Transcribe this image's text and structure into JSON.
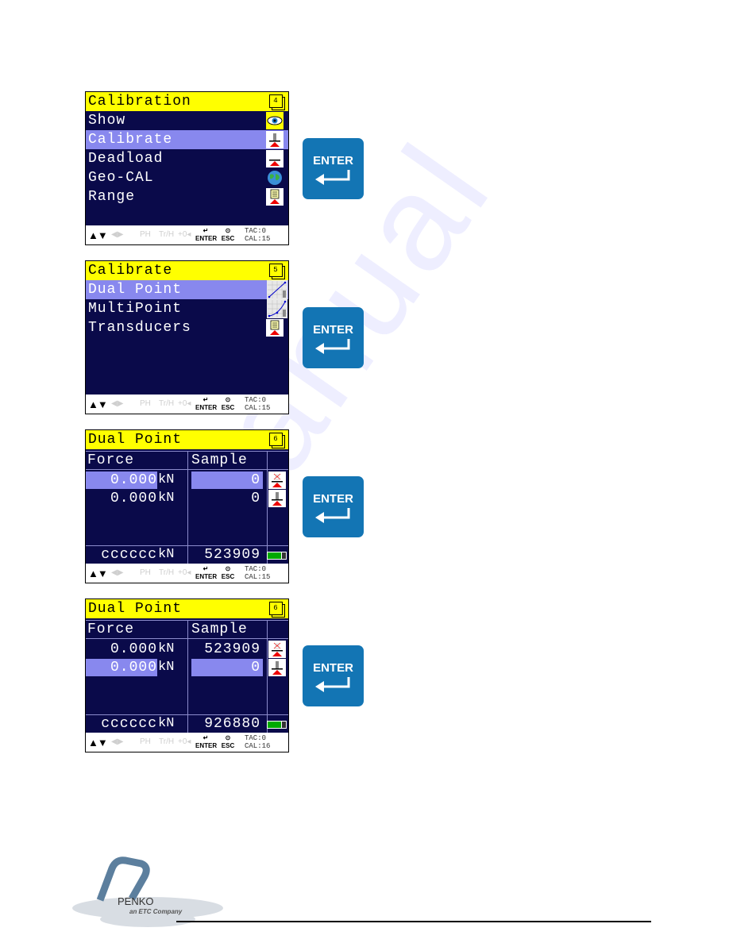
{
  "watermark": "Manual",
  "screens": [
    {
      "title": "Calibration",
      "page": "4",
      "selected_index": 1,
      "items": [
        {
          "label": "Show",
          "icon": "eye-icon"
        },
        {
          "label": "Calibrate",
          "icon": "weight-calibrate-icon"
        },
        {
          "label": "Deadload",
          "icon": "deadload-icon"
        },
        {
          "label": "Geo-CAL",
          "icon": "globe-icon"
        },
        {
          "label": "Range",
          "icon": "range-document-icon"
        }
      ]
    },
    {
      "title": "Calibrate",
      "page": "5",
      "selected_index": 0,
      "items": [
        {
          "label": "Dual Point",
          "icon": "dual-point-graph-icon"
        },
        {
          "label": "MultiPoint",
          "icon": "multipoint-graph-icon"
        },
        {
          "label": "Transducers",
          "icon": "transducer-document-icon"
        }
      ]
    },
    {
      "title": "Dual Point",
      "page": "6",
      "columns": [
        "Force",
        "Sample"
      ],
      "selected_row": 0,
      "rows": [
        {
          "force": "0.000",
          "unit": "kN",
          "sample": "0",
          "icon": "zero-point-icon"
        },
        {
          "force": "0.000",
          "unit": "kN",
          "sample": "0",
          "icon": "weight-point-icon"
        }
      ],
      "live": {
        "force": "cccccc",
        "unit": "kN",
        "sample": "523909"
      }
    },
    {
      "title": "Dual Point",
      "page": "6",
      "columns": [
        "Force",
        "Sample"
      ],
      "selected_row": 1,
      "rows": [
        {
          "force": "0.000",
          "unit": "kN",
          "sample": "523909",
          "icon": "zero-point-icon"
        },
        {
          "force": "0.000",
          "unit": "kN",
          "sample": "0",
          "icon": "weight-point-icon"
        }
      ],
      "live": {
        "force": "cccccc",
        "unit": "kN",
        "sample": "926880"
      }
    }
  ],
  "statusbars": [
    {
      "arrows": "▲▼",
      "faint1": "◀▶",
      "faint2": "PH",
      "faint3": "Tr/H",
      "faint4": "+0◂",
      "enter": "ENTER",
      "esc": "ESC",
      "tac": "TAC:0",
      "cal": "CAL:15"
    },
    {
      "arrows": "▲▼",
      "faint1": "◀▶",
      "faint2": "PH",
      "faint3": "Tr/H",
      "faint4": "+0◂",
      "enter": "ENTER",
      "esc": "ESC",
      "tac": "TAC:0",
      "cal": "CAL:15"
    },
    {
      "arrows": "▲▼",
      "faint1": "◀▶",
      "faint2": "PH",
      "faint3": "Tr/H",
      "faint4": "+0◂",
      "enter": "ENTER",
      "esc": "ESC",
      "tac": "TAC:0",
      "cal": "CAL:15"
    },
    {
      "arrows": "▲▼",
      "faint1": "◀▶",
      "faint2": "PH",
      "faint3": "Tr/H",
      "faint4": "+0◂",
      "enter": "ENTER",
      "esc": "ESC",
      "tac": "TAC:0",
      "cal": "CAL:16"
    }
  ],
  "enter_key_label": "ENTER",
  "colors": {
    "title_bar": "#ffff00",
    "screen_bg": "#0a0a4a",
    "selection": "#8888ee",
    "enter_key": "#1375b4"
  },
  "logo": {
    "name": "PENKO",
    "tagline": "an ETC Company"
  }
}
